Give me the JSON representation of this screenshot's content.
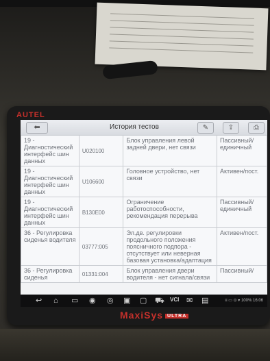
{
  "device": {
    "brand_top": "AUTEL",
    "brand_bottom": "MaxiSys",
    "brand_badge": "ULTRA",
    "brand_color": "#c4302b"
  },
  "toolbar": {
    "back_icon": "back-arrow-icon",
    "title": "История тестов",
    "icons": [
      "edit-icon",
      "share-icon",
      "print-icon"
    ]
  },
  "table": {
    "rows": [
      {
        "system": "19 - Диагностический интерфейс шин данных",
        "code": "U020100",
        "description": "Блок управления левой задней двери, нет связи",
        "status": "Пассивный/единичный"
      },
      {
        "system": "19 - Диагностический интерфейс шин данных",
        "code": "U106600",
        "description": "Головное устройство, нет связи",
        "status": "Активен/пост."
      },
      {
        "system": "19 - Диагностический интерфейс шин данных",
        "code": "B130E00",
        "description": "Ограничение работоспособности, рекомендация перерыва",
        "status": "Пассивный/единичный"
      },
      {
        "system": "36 - Регулировка сиденья водителя",
        "code": "03777:005",
        "description": "Эл.дв. регулировки продольного положения поясничного подпора - отсутствует или неверная базовая установка/адаптация",
        "status": "Активен/пост."
      },
      {
        "system": "36 - Регулировка сиденья",
        "code": "01331:004",
        "description": "Блок управления двери водителя - нет сигнала/связи",
        "status": "Пассивный/"
      }
    ]
  },
  "navbar": {
    "icons": [
      "back-icon",
      "home-icon",
      "recent-apps-icon",
      "chrome-icon",
      "camera-icon",
      "screen-icon",
      "display-icon",
      "car-icon",
      "vcl-icon",
      "mail-icon",
      "pdf-icon"
    ],
    "vcl_label": "VCI",
    "status_text": "≡ ▭ ⊙ ▾ 100% 16:06"
  }
}
